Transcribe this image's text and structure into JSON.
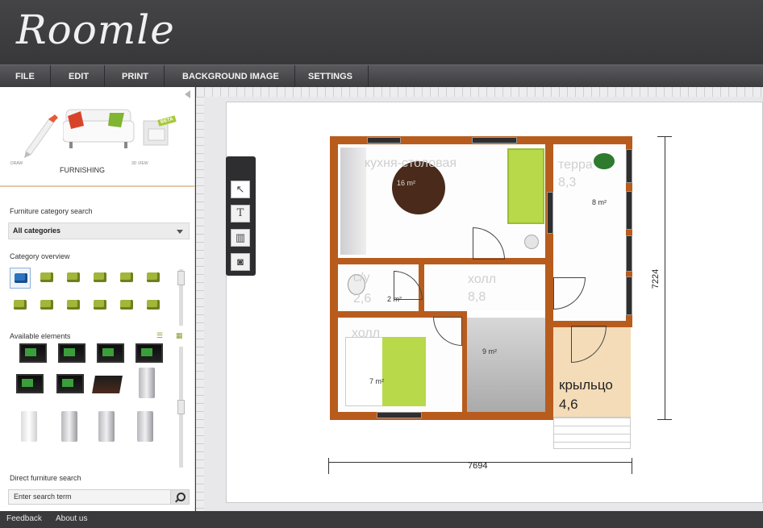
{
  "app": {
    "logo": "Roomle"
  },
  "menu": [
    "FILE",
    "EDIT",
    "PRINT",
    "BACKGROUND IMAGE",
    "SETTINGS"
  ],
  "modes": {
    "draw": "DRAW",
    "furnishing": "FURNISHING",
    "view3d": "3D VIEW",
    "beta": "BETA"
  },
  "category_search": {
    "label": "Furniture category search",
    "selected": "All categories"
  },
  "category_overview": {
    "label": "Category overview"
  },
  "available": {
    "label": "Available elements"
  },
  "direct_search": {
    "label": "Direct furniture search",
    "placeholder": "Enter search term"
  },
  "footer": {
    "feedback": "Feedback",
    "about": "About us"
  },
  "plan": {
    "rooms": {
      "kitchen": {
        "name": "кухня-столовая",
        "area": "16 m²"
      },
      "terrace": {
        "name": "терра",
        "value": "8,3",
        "area": "8 m²"
      },
      "bath": {
        "name": "с/у",
        "value": "2,6",
        "area": "2 m²"
      },
      "hall": {
        "name": "холл",
        "value": "8,8",
        "area": "9 m²"
      },
      "bedroom": {
        "name": "холл",
        "area": "7 m²"
      },
      "porch": {
        "name": "крыльцо",
        "value": "4,6"
      }
    },
    "dimensions": {
      "width": "7694",
      "height": "7224"
    }
  },
  "colors": {
    "wall": "#b85c1e",
    "porch": "#f4dcb8",
    "accent": "#a8c93a"
  }
}
